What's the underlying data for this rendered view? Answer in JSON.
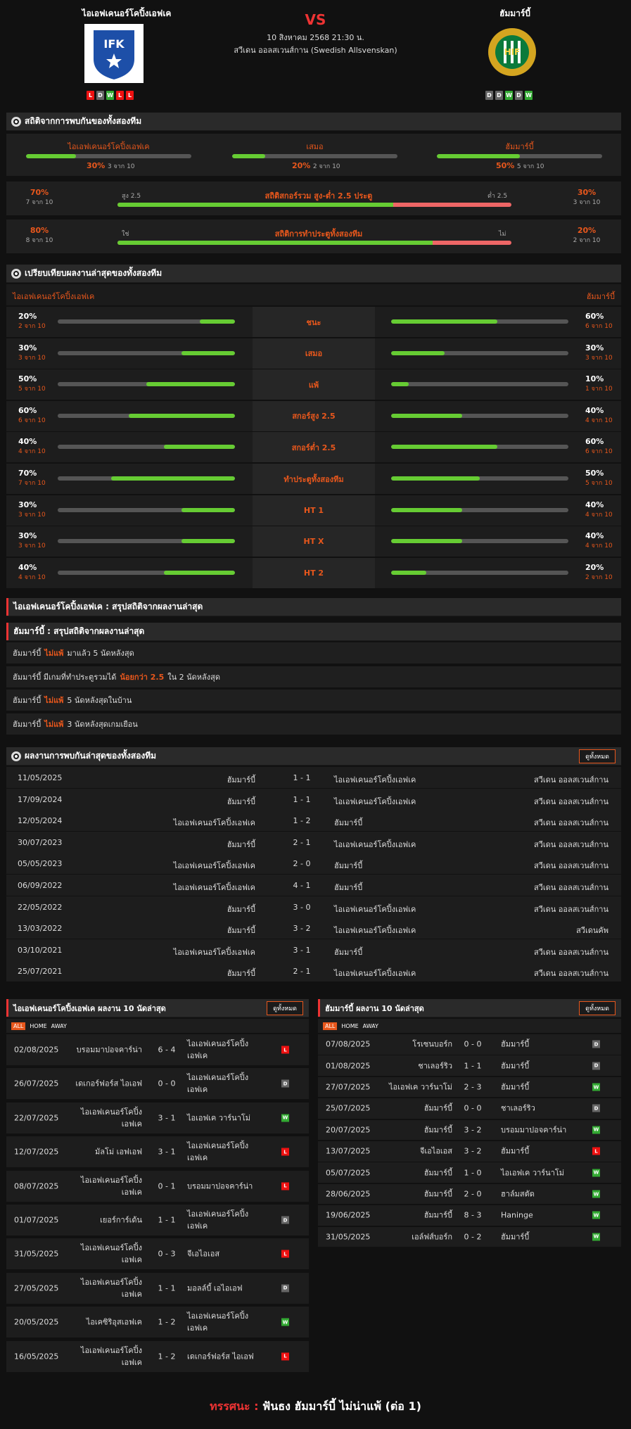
{
  "header": {
    "home": "ไอเอฟเคนอร์โคปิ้งเอฟเค",
    "away": "ฮัมมาร์บี้",
    "vs": "VS",
    "datetime": "10 สิงหาคม 2568 21:30 น.",
    "league": "สวีเดน ออลสเวนส์กาน (Swedish Allsvenskan)",
    "home_form": [
      "L",
      "D",
      "W",
      "L",
      "L"
    ],
    "away_form": [
      "D",
      "D",
      "W",
      "D",
      "W"
    ]
  },
  "h2h_stats": {
    "title": "สถิติจากการพบกันของทั้งสองทีม",
    "home_label": "ไอเอฟเคนอร์โคปิ้งเอฟเค",
    "home_pct": "30%",
    "home_cnt": "3 จาก 10",
    "draw_label": "เสมอ",
    "draw_pct": "20%",
    "draw_cnt": "2 จาก 10",
    "away_label": "ฮัมมาร์บี้",
    "away_pct": "50%",
    "away_cnt": "5 จาก 10",
    "home_val": 0.3,
    "draw_val": 0.2,
    "away_val": 0.5,
    "ou": {
      "title": "สถิติสกอร์รวม สูง-ต่ำ 2.5 ประตู",
      "left_pct": "70%",
      "left_cnt": "7 จาก 10",
      "left_lbl": "สูง 2.5",
      "right_lbl": "ต่ำ 2.5",
      "right_pct": "30%",
      "right_cnt": "3 จาก 10",
      "val": 0.7
    },
    "btts": {
      "title": "สถิติการทำประตูทั้งสองทีม",
      "left_pct": "80%",
      "left_cnt": "8 จาก 10",
      "left_lbl": "ใช่",
      "right_lbl": "ไม่",
      "right_pct": "20%",
      "right_cnt": "2 จาก 10",
      "val": 0.8
    }
  },
  "compare": {
    "title": "เปรียบเทียบผลงานล่าสุดของทั้งสองทีม",
    "home": "ไอเอฟเคนอร์โคปิ้งเอฟเค",
    "away": "ฮัมมาร์บี้",
    "rows": [
      {
        "label": "ชนะ",
        "lp": "20%",
        "lc": "2 จาก 10",
        "lv": 0.2,
        "rp": "60%",
        "rc": "6 จาก 10",
        "rv": 0.6
      },
      {
        "label": "เสมอ",
        "lp": "30%",
        "lc": "3 จาก 10",
        "lv": 0.3,
        "rp": "30%",
        "rc": "3 จาก 10",
        "rv": 0.3
      },
      {
        "label": "แพ้",
        "lp": "50%",
        "lc": "5 จาก 10",
        "lv": 0.5,
        "rp": "10%",
        "rc": "1 จาก 10",
        "rv": 0.1
      },
      {
        "label": "สกอร์สูง 2.5",
        "lp": "60%",
        "lc": "6 จาก 10",
        "lv": 0.6,
        "rp": "40%",
        "rc": "4 จาก 10",
        "rv": 0.4
      },
      {
        "label": "สกอร์ต่ำ 2.5",
        "lp": "40%",
        "lc": "4 จาก 10",
        "lv": 0.4,
        "rp": "60%",
        "rc": "6 จาก 10",
        "rv": 0.6
      },
      {
        "label": "ทำประตูทั้งสองทีม",
        "lp": "70%",
        "lc": "7 จาก 10",
        "lv": 0.7,
        "rp": "50%",
        "rc": "5 จาก 10",
        "rv": 0.5
      },
      {
        "label": "HT 1",
        "lp": "30%",
        "lc": "3 จาก 10",
        "lv": 0.3,
        "rp": "40%",
        "rc": "4 จาก 10",
        "rv": 0.4
      },
      {
        "label": "HT X",
        "lp": "30%",
        "lc": "3 จาก 10",
        "lv": 0.3,
        "rp": "40%",
        "rc": "4 จาก 10",
        "rv": 0.4
      },
      {
        "label": "HT 2",
        "lp": "40%",
        "lc": "4 จาก 10",
        "lv": 0.4,
        "rp": "20%",
        "rc": "2 จาก 10",
        "rv": 0.2
      }
    ]
  },
  "summary": {
    "home_title": "ไอเอฟเคนอร์โคปิ้งเอฟเค : สรุปสถิติจากผลงานล่าสุด",
    "away_title": "ฮัมมาร์บี้ : สรุปสถิติจากผลงานล่าสุด",
    "lines": [
      {
        "a": "ฮัมมาร์บี้",
        "b": "ไม่แพ้",
        "c": "มาแล้ว 5 นัดหลังสุด"
      },
      {
        "a": "ฮัมมาร์บี้ มีเกมที่ทำประตูรวมได้",
        "b": "น้อยกว่า 2.5",
        "c": "ใน 2 นัดหลังสุด"
      },
      {
        "a": "ฮัมมาร์บี้",
        "b": "ไม่แพ้",
        "c": "5 นัดหลังสุดในบ้าน"
      },
      {
        "a": "ฮัมมาร์บี้",
        "b": "ไม่แพ้",
        "c": "3 นัดหลังสุดเกมเยือน"
      }
    ]
  },
  "h2h": {
    "title": "ผลงานการพบกันล่าสุดของทั้งสองทีม",
    "view_all": "ดูทั้งหมด",
    "rows": [
      [
        "11/05/2025",
        "ฮัมมาร์บี้",
        "1 - 1",
        "ไอเอฟเคนอร์โคปิ้งเอฟเค",
        "สวีเดน ออลสเวนส์กาน"
      ],
      [
        "17/09/2024",
        "ฮัมมาร์บี้",
        "1 - 1",
        "ไอเอฟเคนอร์โคปิ้งเอฟเค",
        "สวีเดน ออลสเวนส์กาน"
      ],
      [
        "12/05/2024",
        "ไอเอฟเคนอร์โคปิ้งเอฟเค",
        "1 - 2",
        "ฮัมมาร์บี้",
        "สวีเดน ออลสเวนส์กาน"
      ],
      [
        "30/07/2023",
        "ฮัมมาร์บี้",
        "2 - 1",
        "ไอเอฟเคนอร์โคปิ้งเอฟเค",
        "สวีเดน ออลสเวนส์กาน"
      ],
      [
        "05/05/2023",
        "ไอเอฟเคนอร์โคปิ้งเอฟเค",
        "2 - 0",
        "ฮัมมาร์บี้",
        "สวีเดน ออลสเวนส์กาน"
      ],
      [
        "06/09/2022",
        "ไอเอฟเคนอร์โคปิ้งเอฟเค",
        "4 - 1",
        "ฮัมมาร์บี้",
        "สวีเดน ออลสเวนส์กาน"
      ],
      [
        "22/05/2022",
        "ฮัมมาร์บี้",
        "3 - 0",
        "ไอเอฟเคนอร์โคปิ้งเอฟเค",
        "สวีเดน ออลสเวนส์กาน"
      ],
      [
        "13/03/2022",
        "ฮัมมาร์บี้",
        "3 - 2",
        "ไอเอฟเคนอร์โคปิ้งเอฟเค",
        "สวีเดนคัพ"
      ],
      [
        "03/10/2021",
        "ไอเอฟเคนอร์โคปิ้งเอฟเค",
        "3 - 1",
        "ฮัมมาร์บี้",
        "สวีเดน ออลสเวนส์กาน"
      ],
      [
        "25/07/2021",
        "ฮัมมาร์บี้",
        "2 - 1",
        "ไอเอฟเคนอร์โคปิ้งเอฟเค",
        "สวีเดน ออลสเวนส์กาน"
      ]
    ]
  },
  "home_recent": {
    "title": "ไอเอฟเคนอร์โคปิ้งเอฟเค ผลงาน 10 นัดล่าสุด",
    "view_all": "ดูทั้งหมด",
    "tabs": [
      "ALL",
      "HOME",
      "AWAY"
    ],
    "rows": [
      [
        "02/08/2025",
        "บรอมมาปอจคาร์น่า",
        "6 - 4",
        "ไอเอฟเคนอร์โคปิ้ง เอฟเค",
        "L"
      ],
      [
        "26/07/2025",
        "เดเกอร์ฟอร์ส ไอเอฟ",
        "0 - 0",
        "ไอเอฟเคนอร์โคปิ้ง เอฟเค",
        "D"
      ],
      [
        "22/07/2025",
        "ไอเอฟเคนอร์โคปิ้ง เอฟเค",
        "3 - 1",
        "ไอเอฟเค วาร์นาโม่",
        "W"
      ],
      [
        "12/07/2025",
        "มัลโม่ เอฟเอฟ",
        "3 - 1",
        "ไอเอฟเคนอร์โคปิ้ง เอฟเค",
        "L"
      ],
      [
        "08/07/2025",
        "ไอเอฟเคนอร์โคปิ้ง เอฟเค",
        "0 - 1",
        "บรอมมาปอจคาร์น่า",
        "L"
      ],
      [
        "01/07/2025",
        "เยอร์การ์เด้น",
        "1 - 1",
        "ไอเอฟเคนอร์โคปิ้ง เอฟเค",
        "D"
      ],
      [
        "31/05/2025",
        "ไอเอฟเคนอร์โคปิ้ง เอฟเค",
        "0 - 3",
        "จีเอไอเอส",
        "L"
      ],
      [
        "27/05/2025",
        "ไอเอฟเคนอร์โคปิ้ง เอฟเค",
        "1 - 1",
        "มอลล์บี้ เอไอเอฟ",
        "D"
      ],
      [
        "20/05/2025",
        "ไอเคซิริอุสเอฟเค",
        "1 - 2",
        "ไอเอฟเคนอร์โคปิ้ง เอฟเค",
        "W"
      ],
      [
        "16/05/2025",
        "ไอเอฟเคนอร์โคปิ้ง เอฟเค",
        "1 - 2",
        "เดเกอร์ฟอร์ส ไอเอฟ",
        "L"
      ]
    ]
  },
  "away_recent": {
    "title": "ฮัมมาร์บี้ ผลงาน 10 นัดล่าสุด",
    "view_all": "ดูทั้งหมด",
    "tabs": [
      "ALL",
      "HOME",
      "AWAY"
    ],
    "rows": [
      [
        "07/08/2025",
        "โรเซนบอร์ก",
        "0 - 0",
        "ฮัมมาร์บี้",
        "D"
      ],
      [
        "01/08/2025",
        "ชาเลอร์ริว",
        "1 - 1",
        "ฮัมมาร์บี้",
        "D"
      ],
      [
        "27/07/2025",
        "ไอเอฟเค วาร์นาโม่",
        "2 - 3",
        "ฮัมมาร์บี้",
        "W"
      ],
      [
        "25/07/2025",
        "ฮัมมาร์บี้",
        "0 - 0",
        "ชาเลอร์ริว",
        "D"
      ],
      [
        "20/07/2025",
        "ฮัมมาร์บี้",
        "3 - 2",
        "บรอมมาปอจคาร์น่า",
        "W"
      ],
      [
        "13/07/2025",
        "จีเอไอเอส",
        "3 - 2",
        "ฮัมมาร์บี้",
        "L"
      ],
      [
        "05/07/2025",
        "ฮัมมาร์บี้",
        "1 - 0",
        "ไอเอฟเค วาร์นาโม่",
        "W"
      ],
      [
        "28/06/2025",
        "ฮัมมาร์บี้",
        "2 - 0",
        "ฮาล์มสตัด",
        "W"
      ],
      [
        "19/06/2025",
        "ฮัมมาร์บี้",
        "8 - 3",
        "Haninge",
        "W"
      ],
      [
        "31/05/2025",
        "เอล์ฟส์บอร์ก",
        "0 - 2",
        "ฮัมมาร์บี้",
        "W"
      ]
    ]
  },
  "verdict": {
    "label": "ทรรศนะ :",
    "text": "ฟันธง ฮัมมาร์บี้ ไม่น่าแพ้ (ต่อ 1)"
  },
  "colors": {
    "accent": "#e8571c",
    "red": "#e33",
    "green": "#6c3"
  }
}
